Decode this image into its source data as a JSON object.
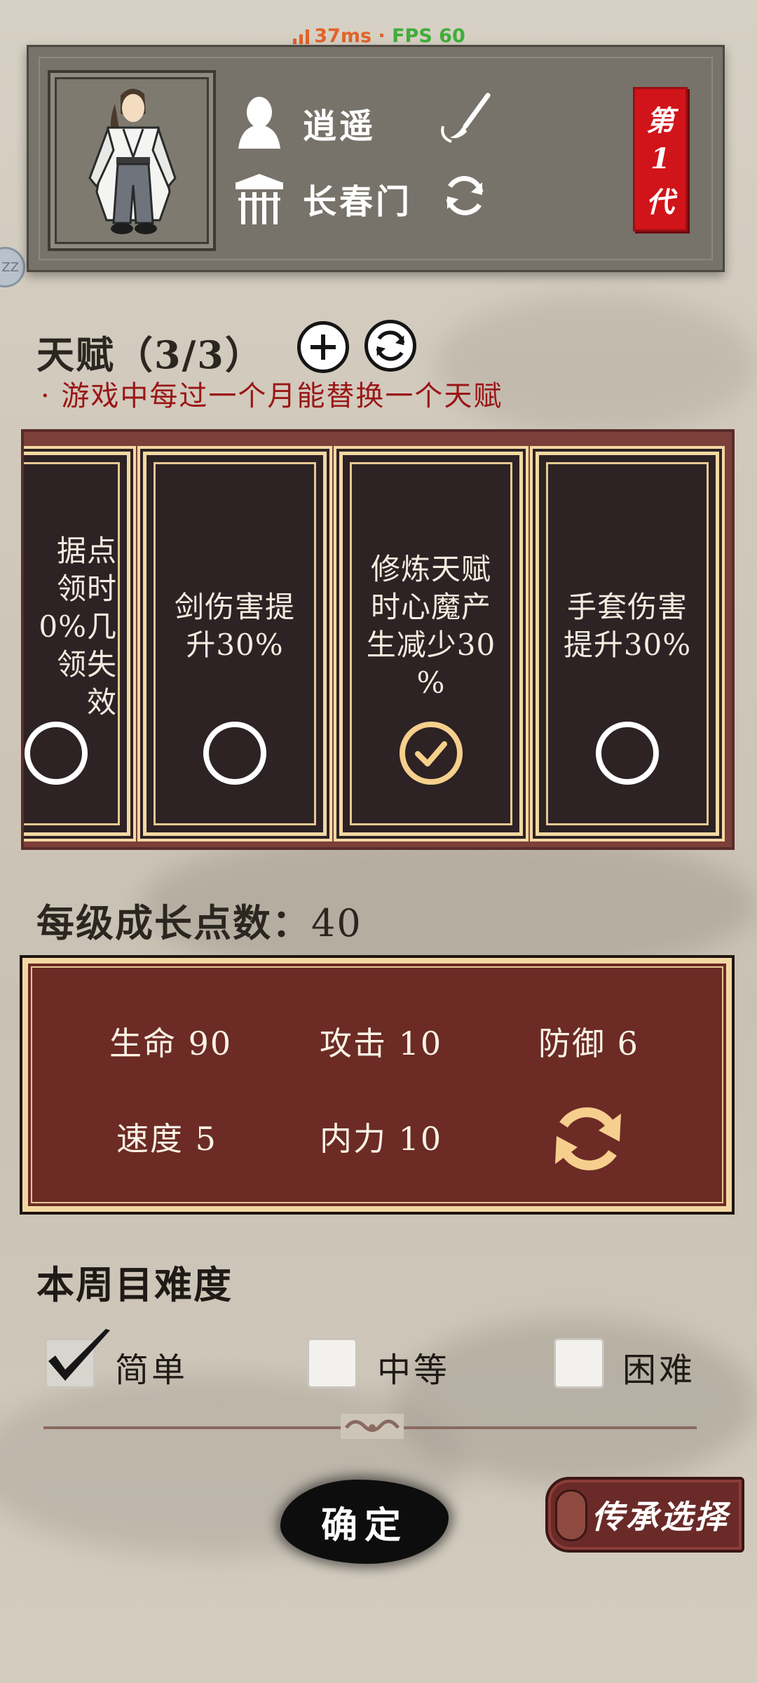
{
  "status": {
    "ping": "37ms",
    "separator": " · ",
    "fps": "FPS 60"
  },
  "side_bubble": {
    "label": "ZZ"
  },
  "header": {
    "name": "逍遥",
    "sect": "长春门",
    "generation": {
      "line1": "第",
      "line2": "1",
      "line3": "代"
    }
  },
  "talents": {
    "title": "天赋（3/3）",
    "note": "· 游戏中每过一个月能替换一个天赋",
    "cards": [
      {
        "text": "据点\n领时\n0%几\n领失\n效",
        "checked": false
      },
      {
        "text": "剑伤害提\n升30%",
        "checked": false
      },
      {
        "text": "修炼天赋\n时心魔产\n生减少30\n%",
        "checked": true
      },
      {
        "text": "手套伤害\n提升30%",
        "checked": false
      }
    ]
  },
  "growth": {
    "label": "每级成长点数：",
    "value": "40",
    "stats": [
      {
        "label": "生命",
        "value": "90"
      },
      {
        "label": "攻击",
        "value": "10"
      },
      {
        "label": "防御",
        "value": "6"
      },
      {
        "label": "速度",
        "value": "5"
      },
      {
        "label": "内力",
        "value": "10"
      }
    ]
  },
  "difficulty": {
    "title": "本周目难度",
    "options": [
      {
        "label": "简单",
        "checked": true
      },
      {
        "label": "中等",
        "checked": false
      },
      {
        "label": "困难",
        "checked": false
      }
    ]
  },
  "buttons": {
    "confirm": "确定",
    "inherit": "传承选择"
  },
  "colors": {
    "panel_red": "#6c2b25",
    "card_dark": "#2d2224",
    "gold_border": "#f3d8a2",
    "badge_red": "#d1141a",
    "note_red": "#9a1616",
    "check_gold": "#f5cf8c"
  }
}
